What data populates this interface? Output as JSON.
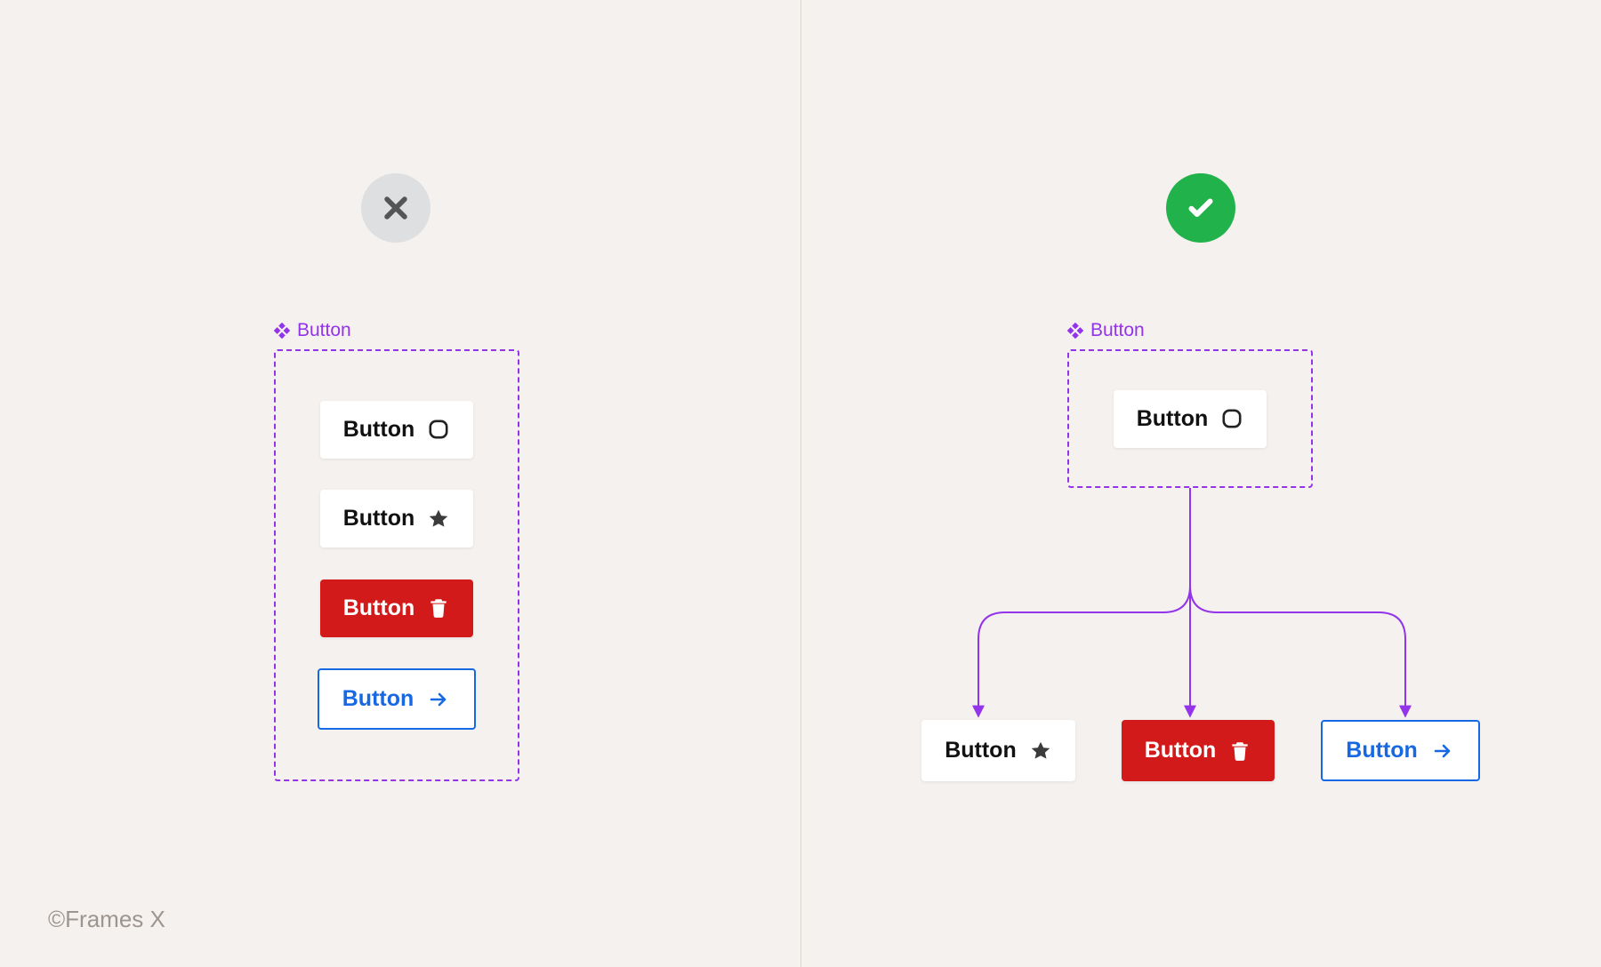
{
  "footer": "©Frames X",
  "left": {
    "component_label": "Button",
    "buttons": [
      {
        "label": "Button",
        "icon": "rounded-square"
      },
      {
        "label": "Button",
        "icon": "star"
      },
      {
        "label": "Button",
        "icon": "trash"
      },
      {
        "label": "Button",
        "icon": "arrow-right"
      }
    ]
  },
  "right": {
    "component_label": "Button",
    "master": {
      "label": "Button",
      "icon": "rounded-square"
    },
    "variants": [
      {
        "label": "Button",
        "icon": "star"
      },
      {
        "label": "Button",
        "icon": "trash"
      },
      {
        "label": "Button",
        "icon": "arrow-right"
      }
    ]
  },
  "colors": {
    "accent_purple": "#9333ea",
    "danger_red": "#d21a1a",
    "link_blue": "#1668e3",
    "success_green": "#22b24c",
    "neutral_gray": "#dedfe1",
    "bg": "#f5f1ee"
  }
}
